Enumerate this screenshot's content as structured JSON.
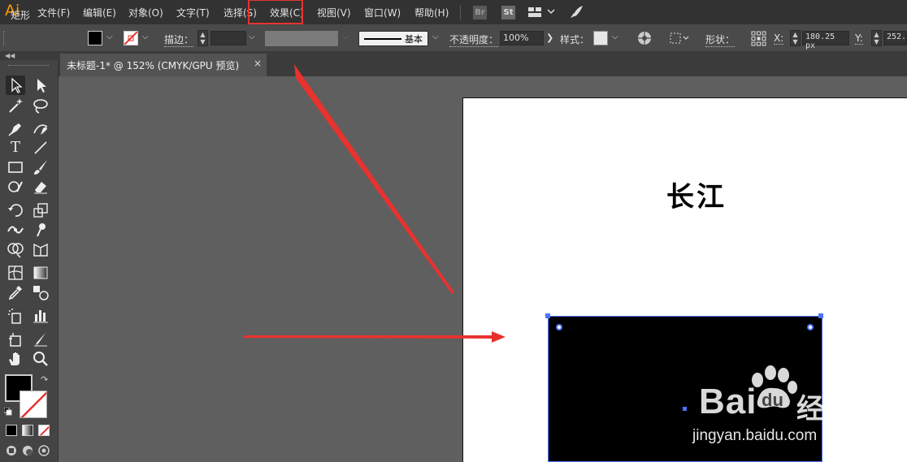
{
  "app": {
    "logo": "Ai"
  },
  "menu": {
    "items": [
      {
        "label": "文件(F)"
      },
      {
        "label": "编辑(E)"
      },
      {
        "label": "对象(O)"
      },
      {
        "label": "文字(T)"
      },
      {
        "label": "选择(S)"
      },
      {
        "label": "效果(C)"
      },
      {
        "label": "视图(V)"
      },
      {
        "label": "窗口(W)"
      },
      {
        "label": "帮助(H)"
      }
    ],
    "bridge_label": "Br",
    "stock_label": "St",
    "highlight_color": "#e8322e"
  },
  "control_bar": {
    "object_type": "矩形",
    "stroke_label": "描边：",
    "stroke_style": "基本",
    "opacity_label": "不透明度：",
    "opacity_value": "100%",
    "style_label": "样式：",
    "shape_label": "形状：",
    "x_label": "X:",
    "x_value": "180.25 px",
    "y_label": "Y:",
    "y_value": "252."
  },
  "document": {
    "tab_title": "未标题-1* @ 152% (CMYK/GPU 预览)",
    "tab_close": "×"
  },
  "artboard": {
    "title_text": "长江",
    "rect_fill": "#000000",
    "selection_color": "#4d73ff"
  },
  "annotations": {
    "arrow_color": "#e8322e"
  },
  "watermark": {
    "brand_latin": "Bai",
    "brand_paw": "du",
    "brand_cn": "经验",
    "url": "jingyan.baidu.com"
  }
}
